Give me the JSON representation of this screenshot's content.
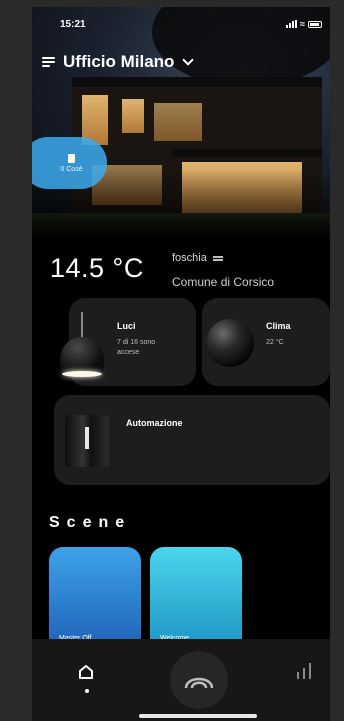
{
  "status_bar": {
    "time": "15:21"
  },
  "header": {
    "location": "Ufficio Milano"
  },
  "hero_pill": {
    "label": "0 Cosè"
  },
  "weather": {
    "temperature": "14.5 °C",
    "condition": "foschia",
    "town": "Comune di Corsico"
  },
  "cards": {
    "lights": {
      "title": "Luci",
      "subtitle": "7 di 16 sono accese"
    },
    "climate": {
      "title": "Clima",
      "subtitle": "22 °C"
    },
    "automation": {
      "title": "Automazione"
    }
  },
  "scenes": {
    "heading": "Scene",
    "items": [
      {
        "label": "Master Off",
        "color": "#2f86dc"
      },
      {
        "label": "Welcome",
        "color": "#36bfe0"
      }
    ]
  },
  "tabbar": {
    "items": [
      {
        "icon": "home-icon",
        "active": true
      },
      {
        "icon": "arch-icon",
        "active": false
      },
      {
        "icon": "stats-icon",
        "active": false
      }
    ]
  }
}
